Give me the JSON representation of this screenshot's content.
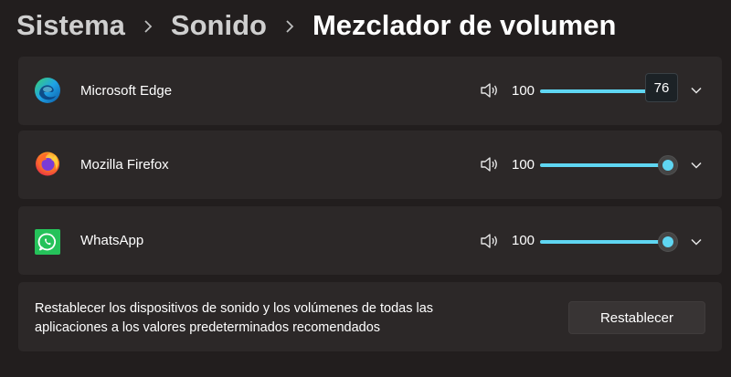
{
  "breadcrumb": {
    "items": [
      "Sistema",
      "Sonido"
    ],
    "current": "Mezclador de volumen"
  },
  "apps": [
    {
      "name": "Microsoft Edge",
      "icon": "edge-icon",
      "volume_label": "100",
      "slider_level": 1.0,
      "tooltip": "76",
      "thumb_visible": false
    },
    {
      "name": "Mozilla Firefox",
      "icon": "firefox-icon",
      "volume_label": "100",
      "slider_level": 1.0,
      "thumb_visible": true
    },
    {
      "name": "WhatsApp",
      "icon": "whatsapp-icon",
      "volume_label": "100",
      "slider_level": 1.0,
      "thumb_visible": true
    }
  ],
  "reset": {
    "description_line1": "Restablecer los dispositivos de sonido y los volúmenes de todas las",
    "description_line2": "aplicaciones a los valores predeterminados recomendados",
    "button_label": "Restablecer"
  },
  "colors": {
    "accent": "#5fd6f2",
    "background": "#221e1e",
    "card": "#2c2828"
  }
}
